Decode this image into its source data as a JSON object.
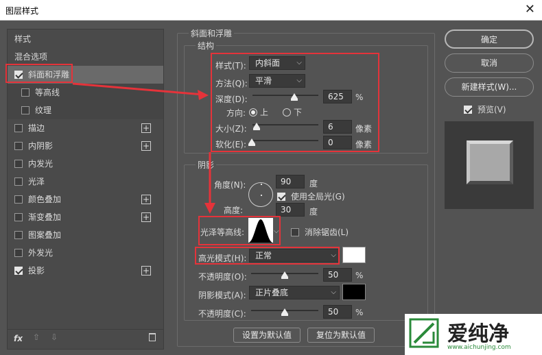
{
  "window": {
    "title": "图层样式",
    "close": "✕"
  },
  "left": {
    "items": [
      {
        "label": "样式",
        "checkbox": false,
        "plus": false
      },
      {
        "label": "混合选项",
        "checkbox": false,
        "plus": false
      },
      {
        "label": "斜面和浮雕",
        "checkbox": true,
        "checked": true,
        "plus": false,
        "selected": true
      },
      {
        "label": "等高线",
        "checkbox": true,
        "checked": false,
        "plus": false,
        "sub": true
      },
      {
        "label": "纹理",
        "checkbox": true,
        "checked": false,
        "plus": false,
        "sub": true
      },
      {
        "label": "描边",
        "checkbox": true,
        "checked": false,
        "plus": true
      },
      {
        "label": "内阴影",
        "checkbox": true,
        "checked": false,
        "plus": true
      },
      {
        "label": "内发光",
        "checkbox": true,
        "checked": false,
        "plus": false
      },
      {
        "label": "光泽",
        "checkbox": true,
        "checked": false,
        "plus": false
      },
      {
        "label": "颜色叠加",
        "checkbox": true,
        "checked": false,
        "plus": true
      },
      {
        "label": "渐变叠加",
        "checkbox": true,
        "checked": false,
        "plus": true
      },
      {
        "label": "图案叠加",
        "checkbox": true,
        "checked": false,
        "plus": false
      },
      {
        "label": "外发光",
        "checkbox": true,
        "checked": false,
        "plus": false
      },
      {
        "label": "投影",
        "checkbox": true,
        "checked": true,
        "plus": true
      }
    ],
    "bottom": {
      "fx": "fx",
      "up": "⇧",
      "down": "⇩",
      "trash": "🗑"
    }
  },
  "bevel": {
    "group_title": "斜面和浮雕",
    "structure_title": "结构",
    "style_label": "样式(T):",
    "style_value": "内斜面",
    "technique_label": "方法(Q):",
    "technique_value": "平滑",
    "depth_label": "深度(D):",
    "depth_value": "625",
    "depth_unit": "%",
    "direction_label": "方向:",
    "dir_up": "上",
    "dir_down": "下",
    "size_label": "大小(Z):",
    "size_value": "6",
    "size_unit": "像素",
    "soften_label": "软化(E):",
    "soften_value": "0",
    "soften_unit": "像素",
    "shading_title": "阴影",
    "angle_label": "角度(N):",
    "angle_value": "90",
    "angle_unit": "度",
    "global_light": "使用全局光(G)",
    "altitude_label": "高度:",
    "altitude_value": "30",
    "altitude_unit": "度",
    "gloss_label": "光泽等高线:",
    "antialias": "消除锯齿(L)",
    "highlight_label": "高光模式(H):",
    "highlight_value": "正常",
    "highlight_color": "#ffffff",
    "opacity1_label": "不透明度(O):",
    "opacity1_value": "50",
    "opacity1_unit": "%",
    "shadow_label": "阴影模式(A):",
    "shadow_value": "正片叠底",
    "shadow_color": "#000000",
    "opacity2_label": "不透明度(C):",
    "opacity2_value": "50",
    "opacity2_unit": "%",
    "set_default": "设置为默认值",
    "reset_default": "复位为默认值"
  },
  "right": {
    "ok": "确定",
    "cancel": "取消",
    "new_style": "新建样式(W)...",
    "preview_label": "预览(V)"
  },
  "watermark": {
    "brand": "爱纯净",
    "url": "www.aichunjing.com"
  }
}
